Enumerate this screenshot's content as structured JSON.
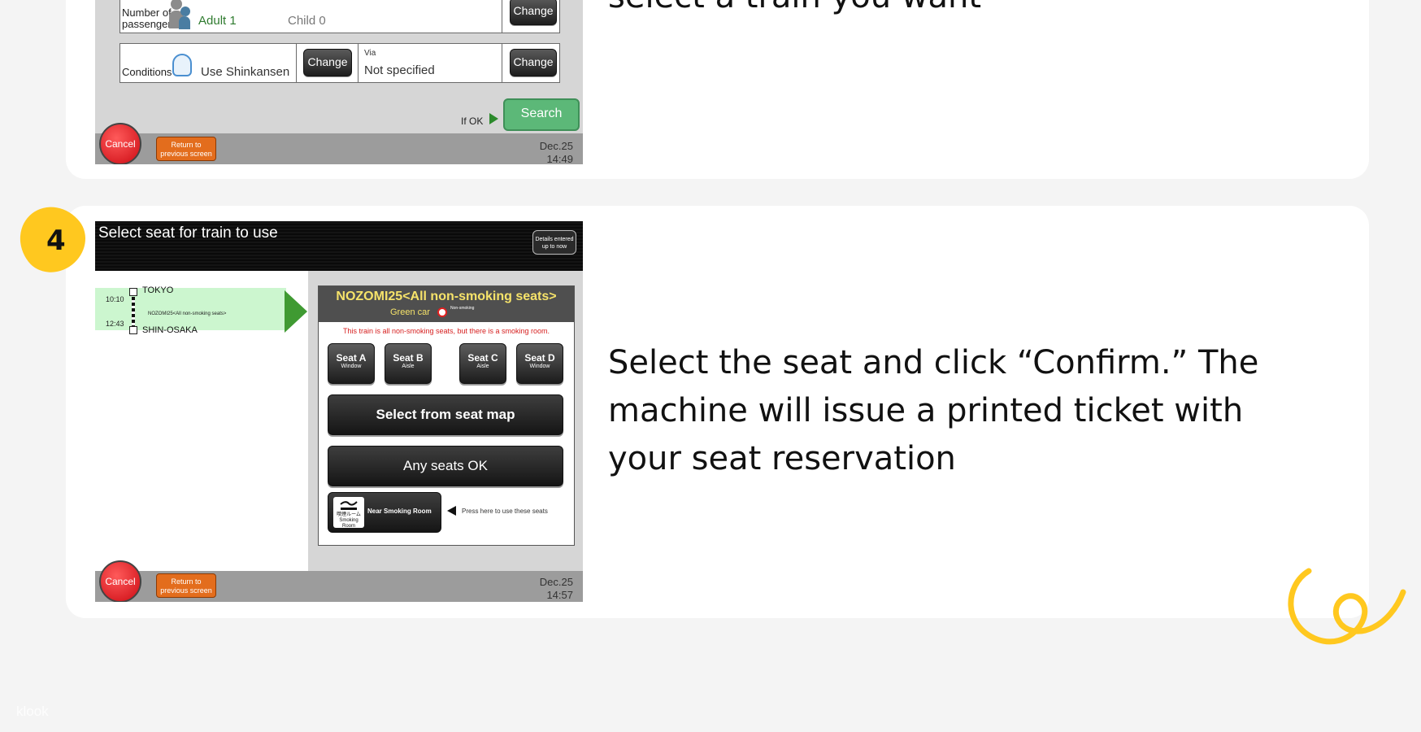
{
  "step3": {
    "heading": "select a train you want",
    "screen": {
      "passengers_label": "Number of passengers",
      "adult": "Adult 1",
      "child": "Child 0",
      "change_label": "Change",
      "conditions_label": "Conditions",
      "conditions_value": "Use Shinkansen",
      "via_label": "Via",
      "via_value": "Not specified",
      "if_ok": "If OK",
      "search_label": "Search",
      "cancel_label": "Cancel",
      "return_label": "Return to previous screen",
      "date": "Dec.25",
      "time": "14:49"
    }
  },
  "step4": {
    "badge": "4",
    "heading": "Select the seat and click “Confirm.” The machine will issue a printed ticket with your seat reservation",
    "screen": {
      "title": "Select seat for train to use",
      "details_button": "Details entered up to now",
      "origin_station": "TOKYO",
      "dest_station": "SHIN-OSAKA",
      "depart_time": "10:10",
      "arrive_time": "12:43",
      "train_label": "NOZOMI25<All non-smoking seats>",
      "train_title": "NOZOMI25<All non-smoking seats>",
      "car_type": "Green car",
      "non_smoking_label": "Non-smoking",
      "notice": "This train is all non-smoking seats, but there is a smoking room.",
      "seats": [
        {
          "name": "Seat A",
          "type": "Window"
        },
        {
          "name": "Seat B",
          "type": "Aisle"
        },
        {
          "name": "Seat C",
          "type": "Aisle"
        },
        {
          "name": "Seat D",
          "type": "Window"
        }
      ],
      "seat_map_button": "Select from seat map",
      "any_seat_button": "Any seats OK",
      "smoking_room_button": "Near Smoking Room",
      "smoking_icon_text": "喫煙ルーム Smoking Room",
      "press_here": "Press here to use these seats",
      "cancel_label": "Cancel",
      "return_label": "Return to previous screen",
      "date": "Dec.25",
      "time": "14:57"
    }
  },
  "watermark": "klook",
  "colors": {
    "accent_yellow": "#ffc81f",
    "search_green": "#5cb878",
    "cancel_red": "#cc0b13",
    "return_orange": "#e36d1d",
    "route_green": "#3f9a32"
  }
}
